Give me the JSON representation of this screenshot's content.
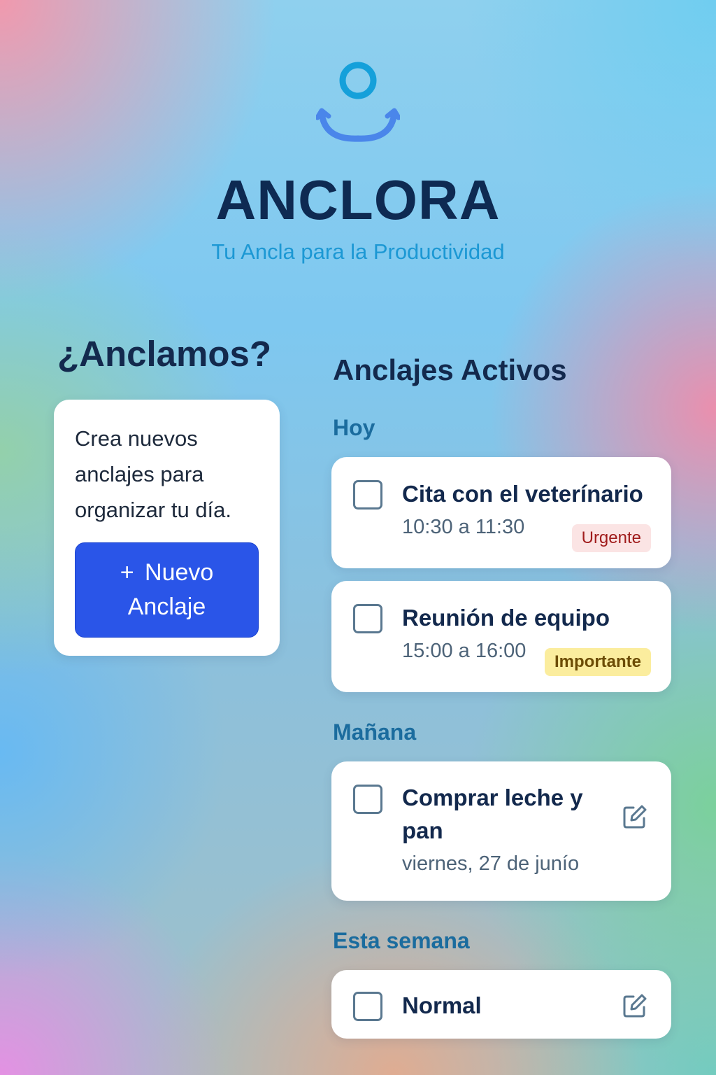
{
  "app": {
    "title": "ANCLORA",
    "subtitle": "Tu Ancla para la Productividad",
    "logo_icon": "anchor-icon"
  },
  "create_panel": {
    "heading": "¿Anclamos?",
    "description": "Crea nuevos anclajes para organizar tu día.",
    "button_plus": "+",
    "button_label": "Nuevo Anclaje"
  },
  "tasks_panel": {
    "heading": "Anclajes Activos",
    "groups": [
      {
        "label": "Hoy",
        "tasks": [
          {
            "title": "Cita con el veterínario",
            "time": "10:30 a 11:30",
            "badge": "Urgente",
            "checked": false
          },
          {
            "title": "Reunión de equipo",
            "time": "15:00 a 16:00",
            "badge": "Importante",
            "checked": false
          }
        ]
      },
      {
        "label": "Mañana",
        "tasks": [
          {
            "title": "Comprar leche y pan",
            "date": "viernes, 27 de junío",
            "icon": "edit-icon",
            "checked": false
          }
        ]
      },
      {
        "label": "Esta semana",
        "tasks": [
          {
            "title": "Normal",
            "icon": "edit-icon",
            "checked": false
          }
        ]
      }
    ]
  },
  "colors": {
    "title": "#0e2a52",
    "subtitle": "#1c98d4",
    "accent_button": "#2a55e8",
    "group_label": "#1b6c9e",
    "urgent_bg": "#fbe4e4",
    "urgent_text": "#a01c1c",
    "important_bg": "#fbed9e",
    "important_text": "#6c4c05"
  }
}
